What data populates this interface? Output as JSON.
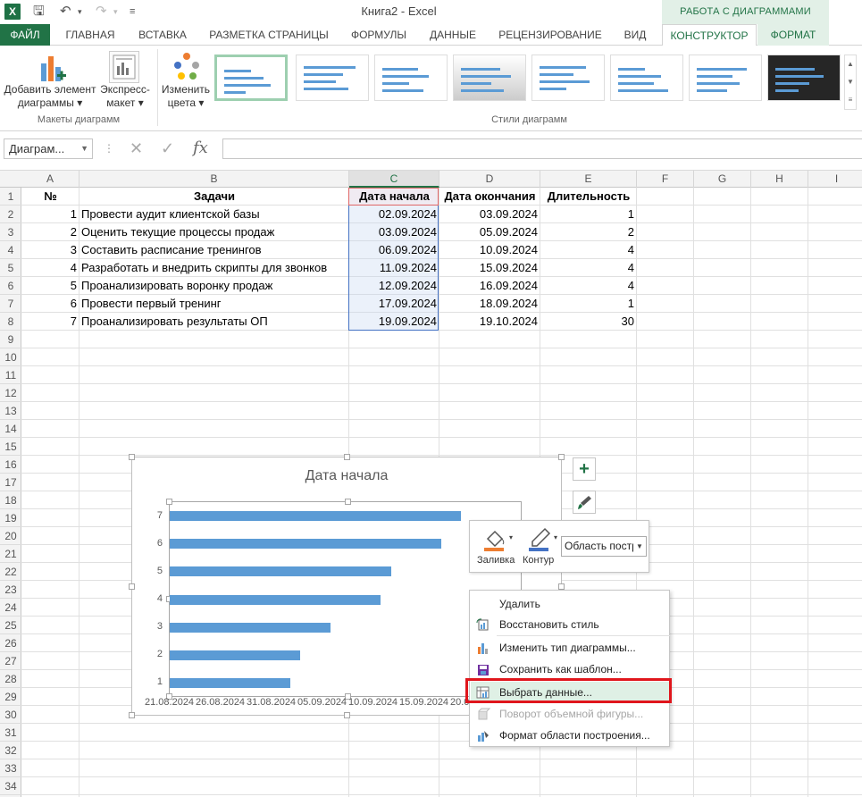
{
  "window": {
    "title": "Книга2 - Excel",
    "context_header": "РАБОТА С ДИАГРАММАМИ"
  },
  "tabs": [
    "ФАЙЛ",
    "ГЛАВНАЯ",
    "ВСТАВКА",
    "РАЗМЕТКА СТРАНИЦЫ",
    "ФОРМУЛЫ",
    "ДАННЫЕ",
    "РЕЦЕНЗИРОВАНИЕ",
    "ВИД",
    "КОНСТРУКТОР",
    "ФОРМАТ"
  ],
  "ribbon": {
    "add_element": [
      "Добавить элемент",
      "диаграммы ▾"
    ],
    "express_layout": [
      "Экспресс-",
      "макет ▾"
    ],
    "change_colors": [
      "Изменить",
      "цвета ▾"
    ],
    "group_layouts": "Макеты диаграмм",
    "group_styles": "Стили диаграмм"
  },
  "formula_bar": {
    "name_box": "Диаграм...",
    "fx": "fx",
    "value": ""
  },
  "columns": [
    "A",
    "B",
    "C",
    "D",
    "E",
    "F",
    "G",
    "H",
    "I"
  ],
  "rows": [
    "1",
    "2",
    "3",
    "4",
    "5",
    "6",
    "7",
    "8",
    "9",
    "10",
    "11",
    "12",
    "13",
    "14",
    "15",
    "16",
    "17",
    "18",
    "19",
    "20",
    "21",
    "22",
    "23",
    "24",
    "25",
    "26",
    "27",
    "28",
    "29",
    "30",
    "31",
    "32",
    "33",
    "34"
  ],
  "table": {
    "headers": [
      "№",
      "Задачи",
      "Дата начала",
      "Дата окончания",
      "Длительность"
    ],
    "rows": [
      [
        "1",
        "Провести аудит клиентской базы",
        "02.09.2024",
        "03.09.2024",
        "1"
      ],
      [
        "2",
        "Оценить текущие процессы продаж",
        "03.09.2024",
        "05.09.2024",
        "2"
      ],
      [
        "3",
        "Составить расписание тренингов",
        "06.09.2024",
        "10.09.2024",
        "4"
      ],
      [
        "4",
        "Разработать и внедрить скрипты для звонков",
        "11.09.2024",
        "15.09.2024",
        "4"
      ],
      [
        "5",
        "Проанализировать воронку продаж",
        "12.09.2024",
        "16.09.2024",
        "4"
      ],
      [
        "6",
        "Провести первый тренинг",
        "17.09.2024",
        "18.09.2024",
        "1"
      ],
      [
        "7",
        "Проанализировать результаты ОП",
        "19.09.2024",
        "19.10.2024",
        "30"
      ]
    ]
  },
  "chart_data": {
    "type": "bar",
    "orientation": "horizontal",
    "title": "Дата начала",
    "categories": [
      "1",
      "2",
      "3",
      "4",
      "5",
      "6",
      "7"
    ],
    "values": [
      "02.09.2024",
      "03.09.2024",
      "06.09.2024",
      "11.09.2024",
      "12.09.2024",
      "17.09.2024",
      "19.09.2024"
    ],
    "x_ticks": [
      "21.08.2024",
      "26.08.2024",
      "31.08.2024",
      "05.09.2024",
      "10.09.2024",
      "15.09.2024",
      "20.0"
    ],
    "xlim": [
      "21.08.2024",
      "25.09.2024"
    ],
    "grid": false,
    "color": "#5b9bd5"
  },
  "mini_toolbar": {
    "fill": "Заливка",
    "outline": "Контур",
    "area": "Область постр"
  },
  "context_menu": [
    {
      "label": "Удалить",
      "enabled": true,
      "icon": "none"
    },
    {
      "label": "Восстановить стиль",
      "enabled": true,
      "icon": "reset-style-icon"
    },
    {
      "label": "Изменить тип диаграммы...",
      "enabled": true,
      "icon": "chart-type-icon"
    },
    {
      "label": "Сохранить как шаблон...",
      "enabled": true,
      "icon": "save-template-icon"
    },
    {
      "label": "Выбрать данные...",
      "enabled": true,
      "icon": "select-data-icon"
    },
    {
      "label": "Поворот объемной фигуры...",
      "enabled": false,
      "icon": "rotate-3d-icon"
    },
    {
      "label": "Формат области построения...",
      "enabled": true,
      "icon": "format-area-icon"
    }
  ],
  "colors": {
    "excel_green": "#217346",
    "bar": "#5b9bd5",
    "highlight_red": "#e0161c"
  }
}
